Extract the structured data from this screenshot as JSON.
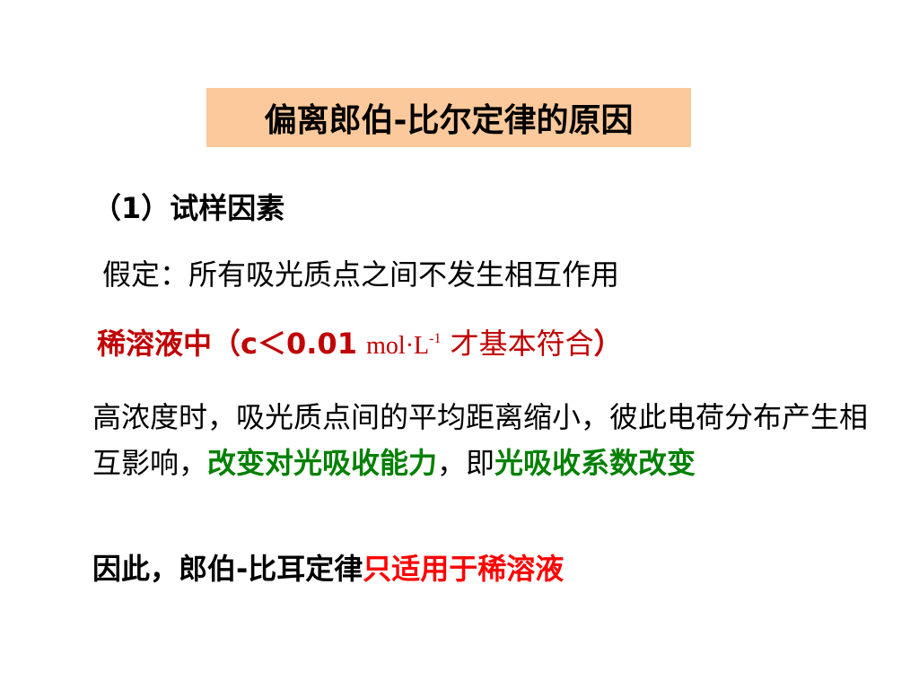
{
  "title": "偏离郎伯-比尔定律的原因",
  "section_heading": "（1）试样因素",
  "assumption": "假定：所有吸光质点之间不发生相互作用",
  "dilute": {
    "label": "稀溶液中",
    "open_paren": "（",
    "condition": "c＜0.01",
    "unit_base": "mol·L",
    "unit_exponent": "-1",
    "tail": "才基本符合",
    "close_paren": "）"
  },
  "paragraph": {
    "part1": "高浓度时，吸光质点间的平均距离缩小，彼此电荷分布产生相互影响，",
    "highlight1": "改变对光吸收能力",
    "part2": "，即",
    "highlight2": "光吸收系数改变"
  },
  "conclusion": {
    "part1": "因此，郎伯-比耳定律",
    "highlight": "只适用于稀溶液"
  },
  "colors": {
    "title_background": "#fbc99b",
    "dark_red": "#c00000",
    "green": "#008000",
    "red": "#ff0000"
  }
}
